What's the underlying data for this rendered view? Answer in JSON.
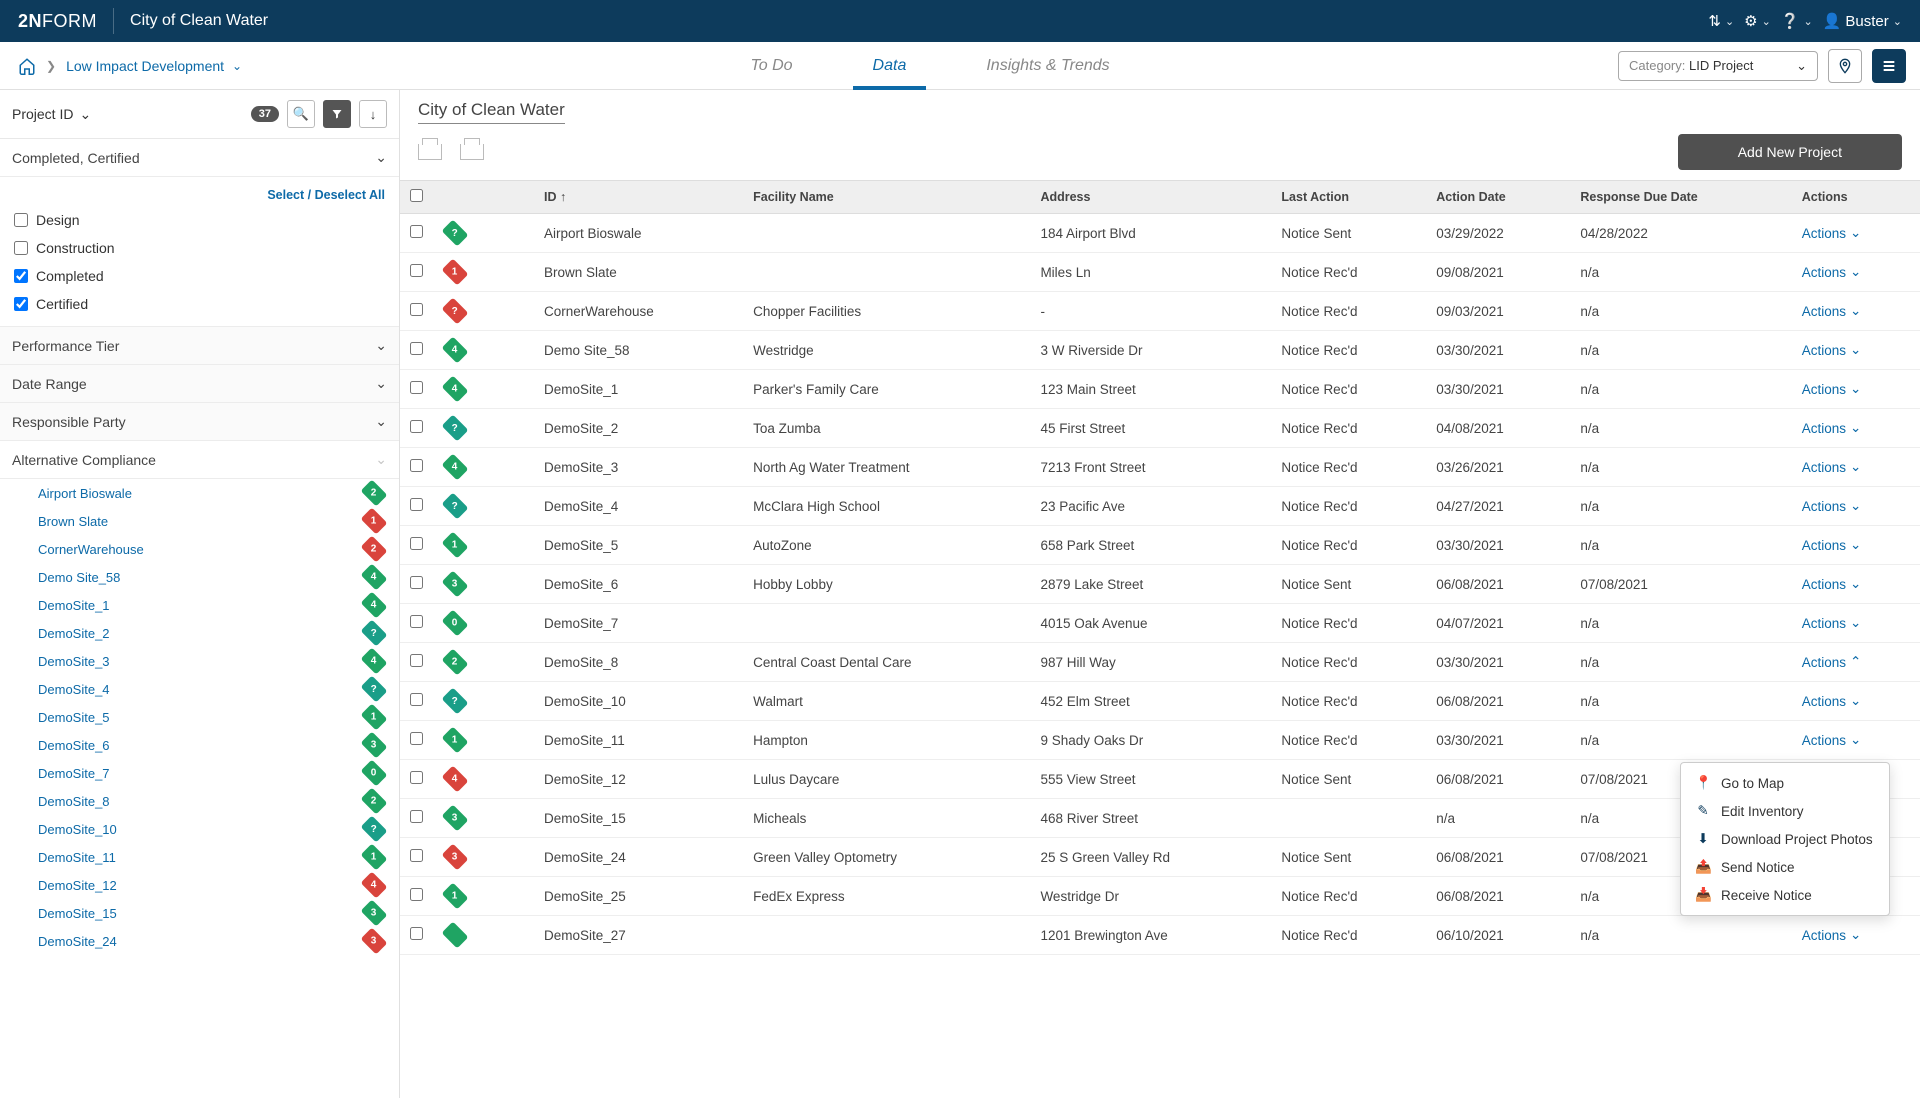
{
  "topbar": {
    "logo_prefix": "2N",
    "logo_suffix": "FORM",
    "app_title": "City of Clean Water",
    "user_name": "Buster"
  },
  "subbar": {
    "crumb": "Low Impact Development",
    "tabs": {
      "todo": "To Do",
      "data": "Data",
      "insights": "Insights & Trends"
    },
    "category_label": "Category:",
    "category_value": "LID Project"
  },
  "sidebar": {
    "project_id": "Project ID",
    "count": "37",
    "sections": {
      "status_title": "Completed, Certified",
      "select_all": "Select / Deselect All",
      "status_options": [
        {
          "label": "Design",
          "checked": false
        },
        {
          "label": "Construction",
          "checked": false
        },
        {
          "label": "Completed",
          "checked": true
        },
        {
          "label": "Certified",
          "checked": true
        }
      ],
      "perf": "Performance Tier",
      "date": "Date Range",
      "resp": "Responsible Party",
      "alt": "Alternative Compliance"
    },
    "projects": [
      {
        "name": "Airport Bioswale",
        "n": "2",
        "c": "green"
      },
      {
        "name": "Brown Slate",
        "n": "1",
        "c": "red"
      },
      {
        "name": "CornerWarehouse",
        "n": "2",
        "c": "red"
      },
      {
        "name": "Demo Site_58",
        "n": "4",
        "c": "green"
      },
      {
        "name": "DemoSite_1",
        "n": "4",
        "c": "green"
      },
      {
        "name": "DemoSite_2",
        "n": "?",
        "c": "teal"
      },
      {
        "name": "DemoSite_3",
        "n": "4",
        "c": "green"
      },
      {
        "name": "DemoSite_4",
        "n": "?",
        "c": "teal"
      },
      {
        "name": "DemoSite_5",
        "n": "1",
        "c": "green"
      },
      {
        "name": "DemoSite_6",
        "n": "3",
        "c": "green"
      },
      {
        "name": "DemoSite_7",
        "n": "0",
        "c": "green"
      },
      {
        "name": "DemoSite_8",
        "n": "2",
        "c": "green"
      },
      {
        "name": "DemoSite_10",
        "n": "?",
        "c": "teal"
      },
      {
        "name": "DemoSite_11",
        "n": "1",
        "c": "green"
      },
      {
        "name": "DemoSite_12",
        "n": "4",
        "c": "red"
      },
      {
        "name": "DemoSite_15",
        "n": "3",
        "c": "green"
      },
      {
        "name": "DemoSite_24",
        "n": "3",
        "c": "red"
      }
    ]
  },
  "content": {
    "title": "City of Clean Water",
    "add_btn": "Add New Project",
    "columns": {
      "id": "ID",
      "facility": "Facility Name",
      "address": "Address",
      "last": "Last Action",
      "date": "Action Date",
      "due": "Response Due Date",
      "actions": "Actions"
    },
    "actions_label": "Actions",
    "rows": [
      {
        "bn": "?",
        "bc": "green",
        "id": "Airport Bioswale",
        "fac": "",
        "addr": "184 Airport Blvd",
        "last": "Notice Sent",
        "date": "03/29/2022",
        "due": "04/28/2022"
      },
      {
        "bn": "1",
        "bc": "red",
        "id": "Brown Slate",
        "fac": "",
        "addr": "Miles Ln",
        "last": "Notice Rec'd",
        "date": "09/08/2021",
        "due": "n/a"
      },
      {
        "bn": "?",
        "bc": "red",
        "id": "CornerWarehouse",
        "fac": "Chopper Facilities",
        "addr": "-",
        "last": "Notice Rec'd",
        "date": "09/03/2021",
        "due": "n/a"
      },
      {
        "bn": "4",
        "bc": "green",
        "id": "Demo Site_58",
        "fac": "Westridge",
        "addr": "3 W Riverside Dr",
        "last": "Notice Rec'd",
        "date": "03/30/2021",
        "due": "n/a"
      },
      {
        "bn": "4",
        "bc": "green",
        "id": "DemoSite_1",
        "fac": "Parker's Family Care",
        "addr": "123 Main Street",
        "last": "Notice Rec'd",
        "date": "03/30/2021",
        "due": "n/a"
      },
      {
        "bn": "?",
        "bc": "teal",
        "id": "DemoSite_2",
        "fac": "Toa Zumba",
        "addr": "45 First Street",
        "last": "Notice Rec'd",
        "date": "04/08/2021",
        "due": "n/a"
      },
      {
        "bn": "4",
        "bc": "green",
        "id": "DemoSite_3",
        "fac": "North Ag Water Treatment",
        "addr": "7213 Front Street",
        "last": "Notice Rec'd",
        "date": "03/26/2021",
        "due": "n/a"
      },
      {
        "bn": "?",
        "bc": "teal",
        "id": "DemoSite_4",
        "fac": "McClara High School",
        "addr": "23 Pacific Ave",
        "last": "Notice Rec'd",
        "date": "04/27/2021",
        "due": "n/a"
      },
      {
        "bn": "1",
        "bc": "green",
        "id": "DemoSite_5",
        "fac": "AutoZone",
        "addr": "658 Park Street",
        "last": "Notice Rec'd",
        "date": "03/30/2021",
        "due": "n/a"
      },
      {
        "bn": "3",
        "bc": "green",
        "id": "DemoSite_6",
        "fac": "Hobby Lobby",
        "addr": "2879 Lake Street",
        "last": "Notice Sent",
        "date": "06/08/2021",
        "due": "07/08/2021"
      },
      {
        "bn": "0",
        "bc": "green",
        "id": "DemoSite_7",
        "fac": "",
        "addr": "4015 Oak Avenue",
        "last": "Notice Rec'd",
        "date": "04/07/2021",
        "due": "n/a"
      },
      {
        "bn": "2",
        "bc": "green",
        "id": "DemoSite_8",
        "fac": "Central Coast Dental Care",
        "addr": "987 Hill Way",
        "last": "Notice Rec'd",
        "date": "03/30/2021",
        "due": "n/a",
        "open": true
      },
      {
        "bn": "?",
        "bc": "teal",
        "id": "DemoSite_10",
        "fac": "Walmart",
        "addr": "452 Elm Street",
        "last": "Notice Rec'd",
        "date": "06/08/2021",
        "due": "n/a"
      },
      {
        "bn": "1",
        "bc": "green",
        "id": "DemoSite_11",
        "fac": "Hampton",
        "addr": "9 Shady Oaks Dr",
        "last": "Notice Rec'd",
        "date": "03/30/2021",
        "due": "n/a"
      },
      {
        "bn": "4",
        "bc": "red",
        "id": "DemoSite_12",
        "fac": "Lulus Daycare",
        "addr": "555 View Street",
        "last": "Notice Sent",
        "date": "06/08/2021",
        "due": "07/08/2021"
      },
      {
        "bn": "3",
        "bc": "green",
        "id": "DemoSite_15",
        "fac": "Micheals",
        "addr": "468 River Street",
        "last": "",
        "date": "n/a",
        "due": "n/a"
      },
      {
        "bn": "3",
        "bc": "red",
        "id": "DemoSite_24",
        "fac": "Green Valley Optometry",
        "addr": "25 S Green Valley Rd",
        "last": "Notice Sent",
        "date": "06/08/2021",
        "due": "07/08/2021"
      },
      {
        "bn": "1",
        "bc": "green",
        "id": "DemoSite_25",
        "fac": "FedEx Express",
        "addr": "Westridge Dr",
        "last": "Notice Rec'd",
        "date": "06/08/2021",
        "due": "n/a"
      },
      {
        "bn": "",
        "bc": "green",
        "id": "DemoSite_27",
        "fac": "",
        "addr": "1201 Brewington Ave",
        "last": "Notice Rec'd",
        "date": "06/10/2021",
        "due": "n/a"
      }
    ]
  },
  "popup": {
    "go_map": "Go to Map",
    "edit": "Edit Inventory",
    "download": "Download Project Photos",
    "send": "Send Notice",
    "receive": "Receive Notice"
  }
}
